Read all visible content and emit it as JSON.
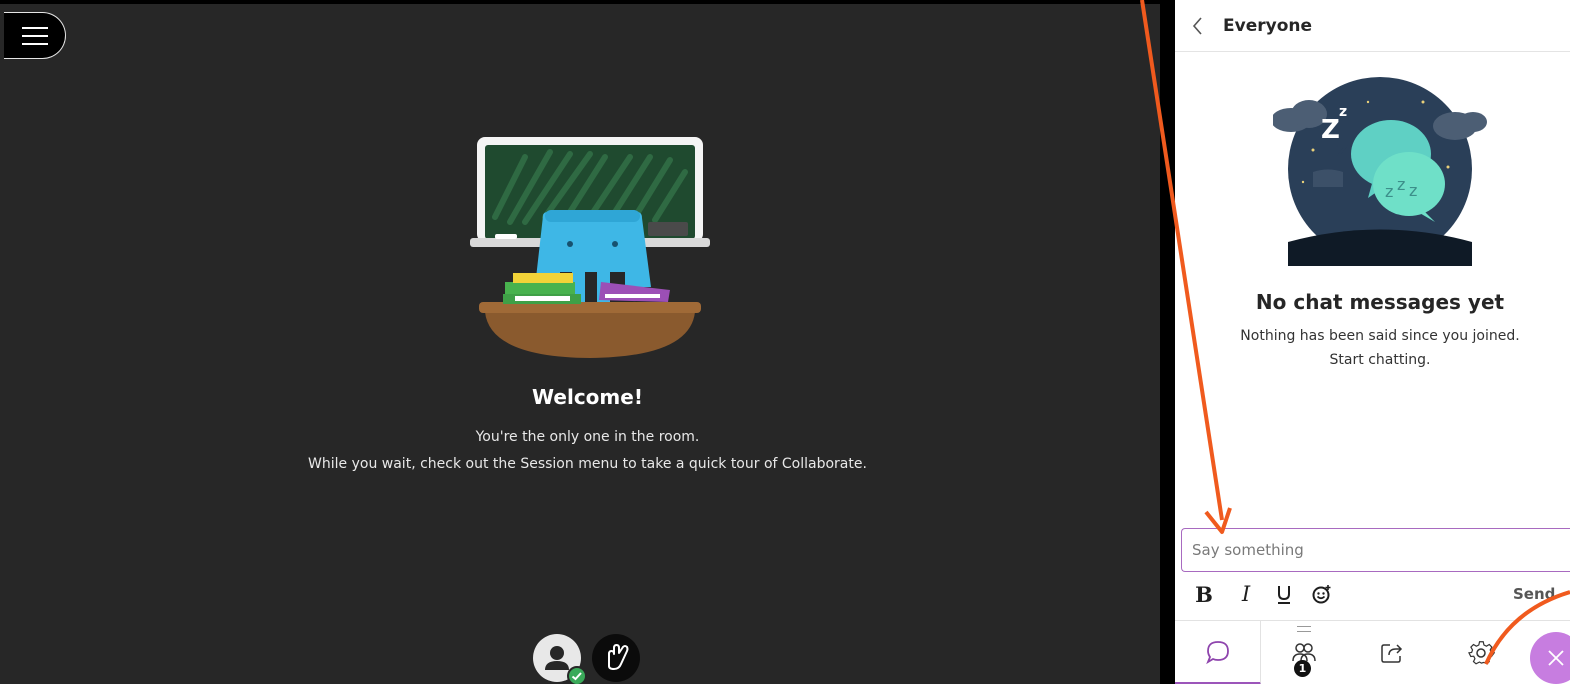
{
  "stage": {
    "menu_icon": "hamburger-menu-icon",
    "welcome_title": "Welcome!",
    "welcome_line_1": "You're the only one in the room.",
    "welcome_line_2": "While you wait, check out the Session menu to take a quick tour of Collaborate.",
    "avatar_icon": "user-avatar-icon",
    "hand_icon": "raise-hand-icon",
    "status_color": "#3aaa5a",
    "background_color": "#272727"
  },
  "chat": {
    "header_title": "Everyone",
    "empty_title": "No chat messages yet",
    "empty_line_1": "Nothing has been said since you joined.",
    "empty_line_2": "Start chatting.",
    "composer_placeholder": "Say something",
    "send_label": "Send",
    "format_icons": [
      "bold-icon",
      "italic-icon",
      "underline-icon",
      "emoji-icon"
    ],
    "accent_color": "#9c55ba"
  },
  "tabbar": {
    "tabs": [
      {
        "icon": "chat-bubble-icon",
        "active": true
      },
      {
        "icon": "attendees-icon",
        "badge": "1"
      },
      {
        "icon": "share-content-icon"
      },
      {
        "icon": "settings-gear-icon"
      }
    ],
    "close_icon": "close-panel-icon"
  },
  "annotations": {
    "arrow_color": "#f05a1e"
  }
}
